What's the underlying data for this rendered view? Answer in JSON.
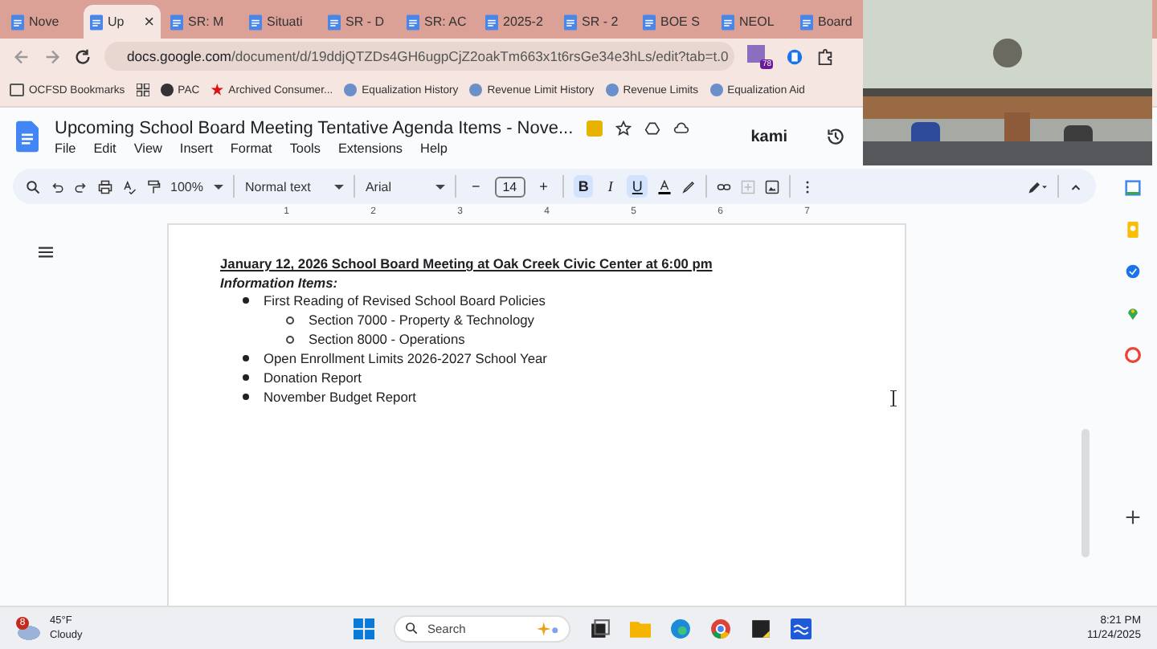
{
  "browser": {
    "tabs": [
      {
        "title": "Nove",
        "selected": false
      },
      {
        "title": "Up",
        "selected": true
      },
      {
        "title": "SR: M",
        "selected": false
      },
      {
        "title": "Situati",
        "selected": false
      },
      {
        "title": "SR - D",
        "selected": false
      },
      {
        "title": "SR: AC",
        "selected": false
      },
      {
        "title": "2025-2",
        "selected": false
      },
      {
        "title": "SR - 2",
        "selected": false
      },
      {
        "title": "BOE S",
        "selected": false
      },
      {
        "title": "NEOL",
        "selected": false
      },
      {
        "title": "Board",
        "selected": false
      }
    ],
    "close": "×",
    "url_host": "docs.google.com",
    "url_path": "/document/d/19ddjQTZDs4GH6ugpCjZ2oakTm663x1t6rsGe34e3hLs/edit?tab=t.0",
    "extension_badge": "78",
    "bookmarks": [
      "OCFSD Bookmarks",
      "PAC",
      "Archived Consumer...",
      "Equalization History",
      "Revenue Limit History",
      "Revenue Limits",
      "Equalization Aid"
    ]
  },
  "docs": {
    "title": "Upcoming School Board Meeting Tentative Agenda Items -  Nove...",
    "menu": [
      "File",
      "Edit",
      "View",
      "Insert",
      "Format",
      "Tools",
      "Extensions",
      "Help"
    ],
    "kami": "kami",
    "toolbar": {
      "zoom": "100%",
      "style": "Normal text",
      "font": "Arial",
      "minus": "−",
      "size": "14",
      "plus": "+",
      "format": [
        {
          "label": "B",
          "selected": true
        },
        {
          "label": "I",
          "selected": false
        },
        {
          "label": "U",
          "selected": true
        }
      ]
    },
    "ruler": [
      "1",
      "2",
      "3",
      "4",
      "5",
      "6",
      "7"
    ],
    "document": {
      "heading": "January 12, 2026  School Board Meeting at Oak Creek Civic Center at 6:00 pm",
      "subheading": "Information Items:",
      "items": [
        {
          "text": "First Reading of Revised School Board Policies",
          "children": [
            {
              "text": "Section 7000 - Property & Technology"
            },
            {
              "text": "Section 8000 - Operations"
            }
          ]
        },
        {
          "text": "Open Enrollment Limits 2026-2027 School Year"
        },
        {
          "text": "Donation Report"
        },
        {
          "text": "November Budget Report"
        }
      ]
    }
  },
  "taskbar": {
    "weather_badge": "8",
    "temperature": "45°F",
    "condition": "Cloudy",
    "search": "Search",
    "time": "8:21 PM",
    "date": "11/24/2025"
  }
}
